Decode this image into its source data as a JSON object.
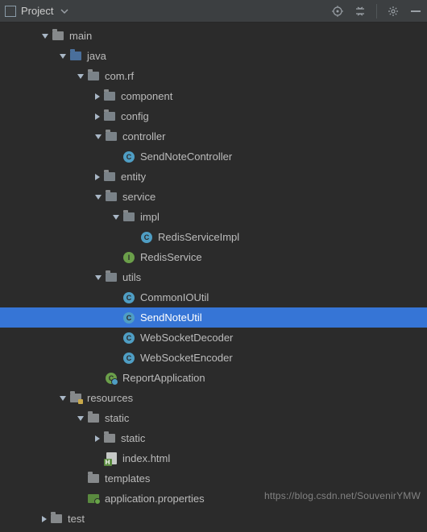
{
  "toolbar": {
    "title": "Project"
  },
  "tree": [
    {
      "indent": 2,
      "arrow": "open",
      "icon": "folder",
      "label": "main"
    },
    {
      "indent": 3,
      "arrow": "open",
      "icon": "folder-source",
      "label": "java"
    },
    {
      "indent": 4,
      "arrow": "open",
      "icon": "folder-pkg",
      "label": "com.rf"
    },
    {
      "indent": 5,
      "arrow": "closed",
      "icon": "folder-pkg",
      "label": "component"
    },
    {
      "indent": 5,
      "arrow": "closed",
      "icon": "folder-pkg",
      "label": "config"
    },
    {
      "indent": 5,
      "arrow": "open",
      "icon": "folder-pkg",
      "label": "controller"
    },
    {
      "indent": 6,
      "arrow": "none",
      "icon": "class",
      "label": "SendNoteController"
    },
    {
      "indent": 5,
      "arrow": "closed",
      "icon": "folder-pkg",
      "label": "entity"
    },
    {
      "indent": 5,
      "arrow": "open",
      "icon": "folder-pkg",
      "label": "service"
    },
    {
      "indent": 6,
      "arrow": "open",
      "icon": "folder-pkg",
      "label": "impl"
    },
    {
      "indent": 7,
      "arrow": "none",
      "icon": "class",
      "label": "RedisServiceImpl"
    },
    {
      "indent": 6,
      "arrow": "none",
      "icon": "interface",
      "label": "RedisService"
    },
    {
      "indent": 5,
      "arrow": "open",
      "icon": "folder-pkg",
      "label": "utils"
    },
    {
      "indent": 6,
      "arrow": "none",
      "icon": "class",
      "label": "CommonIOUtil"
    },
    {
      "indent": 6,
      "arrow": "none",
      "icon": "class",
      "label": "SendNoteUtil",
      "selected": true
    },
    {
      "indent": 6,
      "arrow": "none",
      "icon": "class",
      "label": "WebSocketDecoder"
    },
    {
      "indent": 6,
      "arrow": "none",
      "icon": "class",
      "label": "WebSocketEncoder"
    },
    {
      "indent": 5,
      "arrow": "none",
      "icon": "spring-class",
      "label": "ReportApplication"
    },
    {
      "indent": 3,
      "arrow": "open",
      "icon": "folder-res",
      "label": "resources"
    },
    {
      "indent": 4,
      "arrow": "open",
      "icon": "folder",
      "label": "static"
    },
    {
      "indent": 5,
      "arrow": "closed",
      "icon": "folder",
      "label": "static"
    },
    {
      "indent": 5,
      "arrow": "none",
      "icon": "html",
      "label": "index.html"
    },
    {
      "indent": 4,
      "arrow": "none",
      "icon": "folder",
      "label": "templates"
    },
    {
      "indent": 4,
      "arrow": "none",
      "icon": "properties",
      "label": "application.properties"
    },
    {
      "indent": 2,
      "arrow": "closed",
      "icon": "folder",
      "label": "test"
    }
  ],
  "watermark": "https://blog.csdn.net/SouvenirYMW"
}
